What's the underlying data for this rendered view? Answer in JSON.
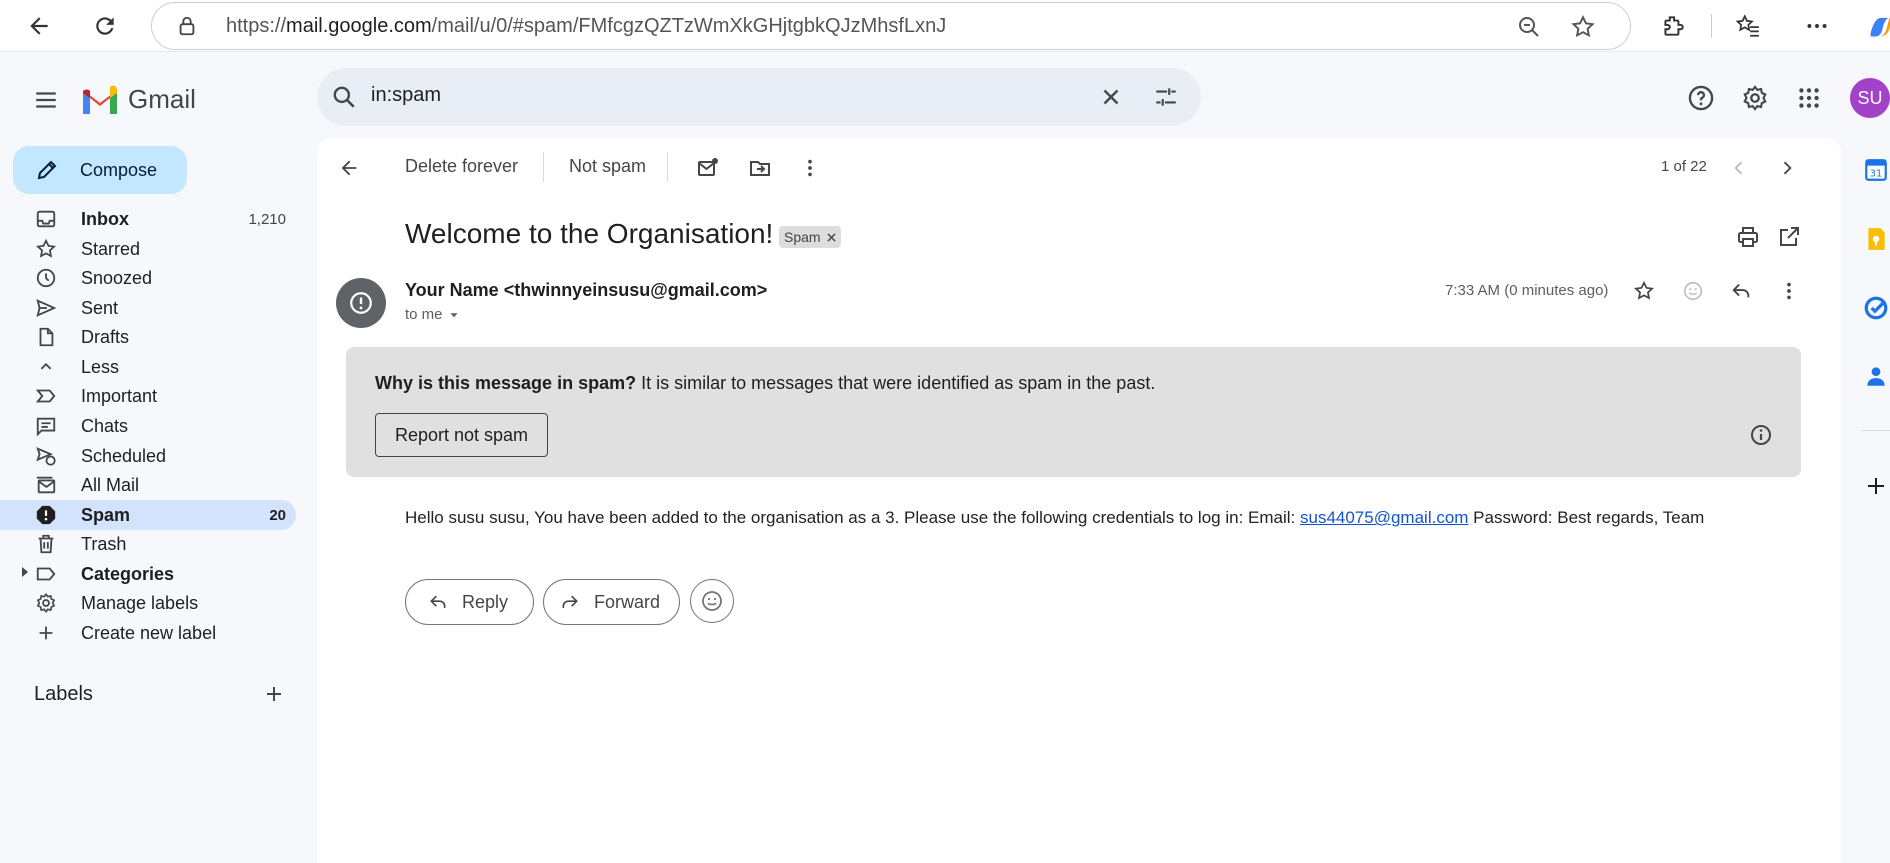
{
  "browser": {
    "url_prefix": "https://",
    "url_domain": "mail.google.com",
    "url_path": "/mail/u/0/#spam/FMfcgzQZTzWmXkGHjtgbkQJzMhsfLxnJ"
  },
  "app": {
    "name": "Gmail",
    "avatar_initials": "SU"
  },
  "search": {
    "query": "in:spam"
  },
  "sidebar": {
    "compose_label": "Compose",
    "items": [
      {
        "label": "Inbox",
        "count": "1,210"
      },
      {
        "label": "Starred",
        "count": ""
      },
      {
        "label": "Snoozed",
        "count": ""
      },
      {
        "label": "Sent",
        "count": ""
      },
      {
        "label": "Drafts",
        "count": ""
      },
      {
        "label": "Less",
        "count": ""
      },
      {
        "label": "Important",
        "count": ""
      },
      {
        "label": "Chats",
        "count": ""
      },
      {
        "label": "Scheduled",
        "count": ""
      },
      {
        "label": "All Mail",
        "count": ""
      },
      {
        "label": "Spam",
        "count": "20"
      },
      {
        "label": "Trash",
        "count": ""
      },
      {
        "label": "Categories",
        "count": ""
      },
      {
        "label": "Manage labels",
        "count": ""
      },
      {
        "label": "Create new label",
        "count": ""
      }
    ],
    "labels_heading": "Labels"
  },
  "toolbar": {
    "delete_forever": "Delete forever",
    "not_spam": "Not spam",
    "pagination": "1 of 22"
  },
  "email": {
    "subject": "Welcome to the Organisation!",
    "spam_chip": "Spam",
    "sender": "Your Name <thwinnyeinsusu@gmail.com>",
    "to": "to me",
    "timestamp": "7:33 AM (0 minutes ago)",
    "warning_bold": "Why is this message in spam?",
    "warning_rest": " It is similar to messages that were identified as spam in the past.",
    "report_not_spam": "Report not spam",
    "body_before": "Hello susu susu, You have been added to the organisation as a 3. Please use the following credentials to log in: Email: ",
    "body_link": "sus44075@gmail.com",
    "body_after": " Password: Best regards, Team",
    "reply": "Reply",
    "forward": "Forward"
  },
  "colors": {
    "accent": "#0b57d0",
    "compose_bg": "#c2e7ff",
    "active_nav": "#d3e3fd",
    "avatar": "#a142c8",
    "link": "#1155cc"
  }
}
